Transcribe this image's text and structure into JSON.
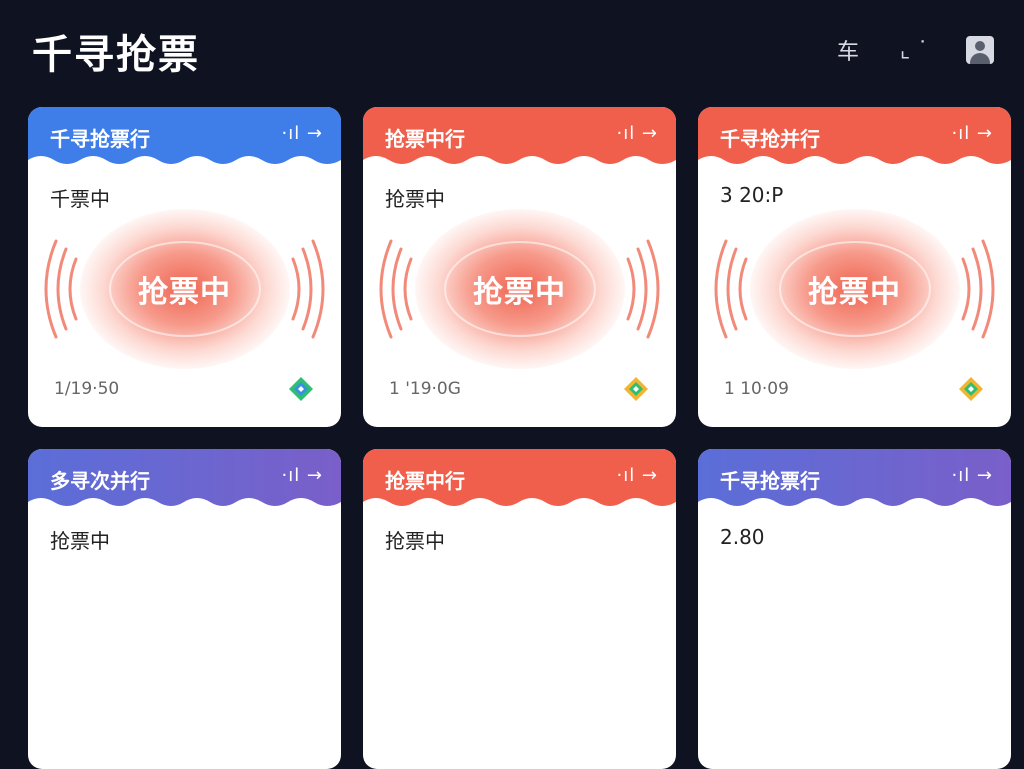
{
  "app": {
    "title": "千寻抢票"
  },
  "toolbar": {
    "train_label": "车",
    "chart_label": "⌞ ˙"
  },
  "cards": [
    {
      "header_title": "千寻抢票行",
      "arrow": "·ıl →",
      "status": "千票中",
      "pulse_label": "抢票中",
      "footer": "1/19·50",
      "theme": "blue"
    },
    {
      "header_title": "抢票中行",
      "arrow": "·ıl →",
      "status": "抢票中",
      "pulse_label": "抢票中",
      "footer": "1 '19·0G",
      "theme": "red"
    },
    {
      "header_title": "千寻抢并行",
      "arrow": "·ıl →",
      "status": "3 20:Р",
      "pulse_label": "抢票中",
      "footer": "1 10·09",
      "theme": "red"
    },
    {
      "header_title": "多寻次并行",
      "arrow": "·ıl →",
      "status": "抢票中",
      "theme": "purple"
    },
    {
      "header_title": "抢票中行",
      "arrow": "·ıl →",
      "status": "抢票中",
      "theme": "red"
    },
    {
      "header_title": "千寻抢票行",
      "arrow": "·ıl →",
      "status": "2.80",
      "theme": "purple"
    }
  ],
  "colors": {
    "background": "#0f1220",
    "blue": "#3f7ee8",
    "red": "#ef5f4c",
    "purple": "#6a66d0",
    "pulse": "#ee5c48"
  }
}
